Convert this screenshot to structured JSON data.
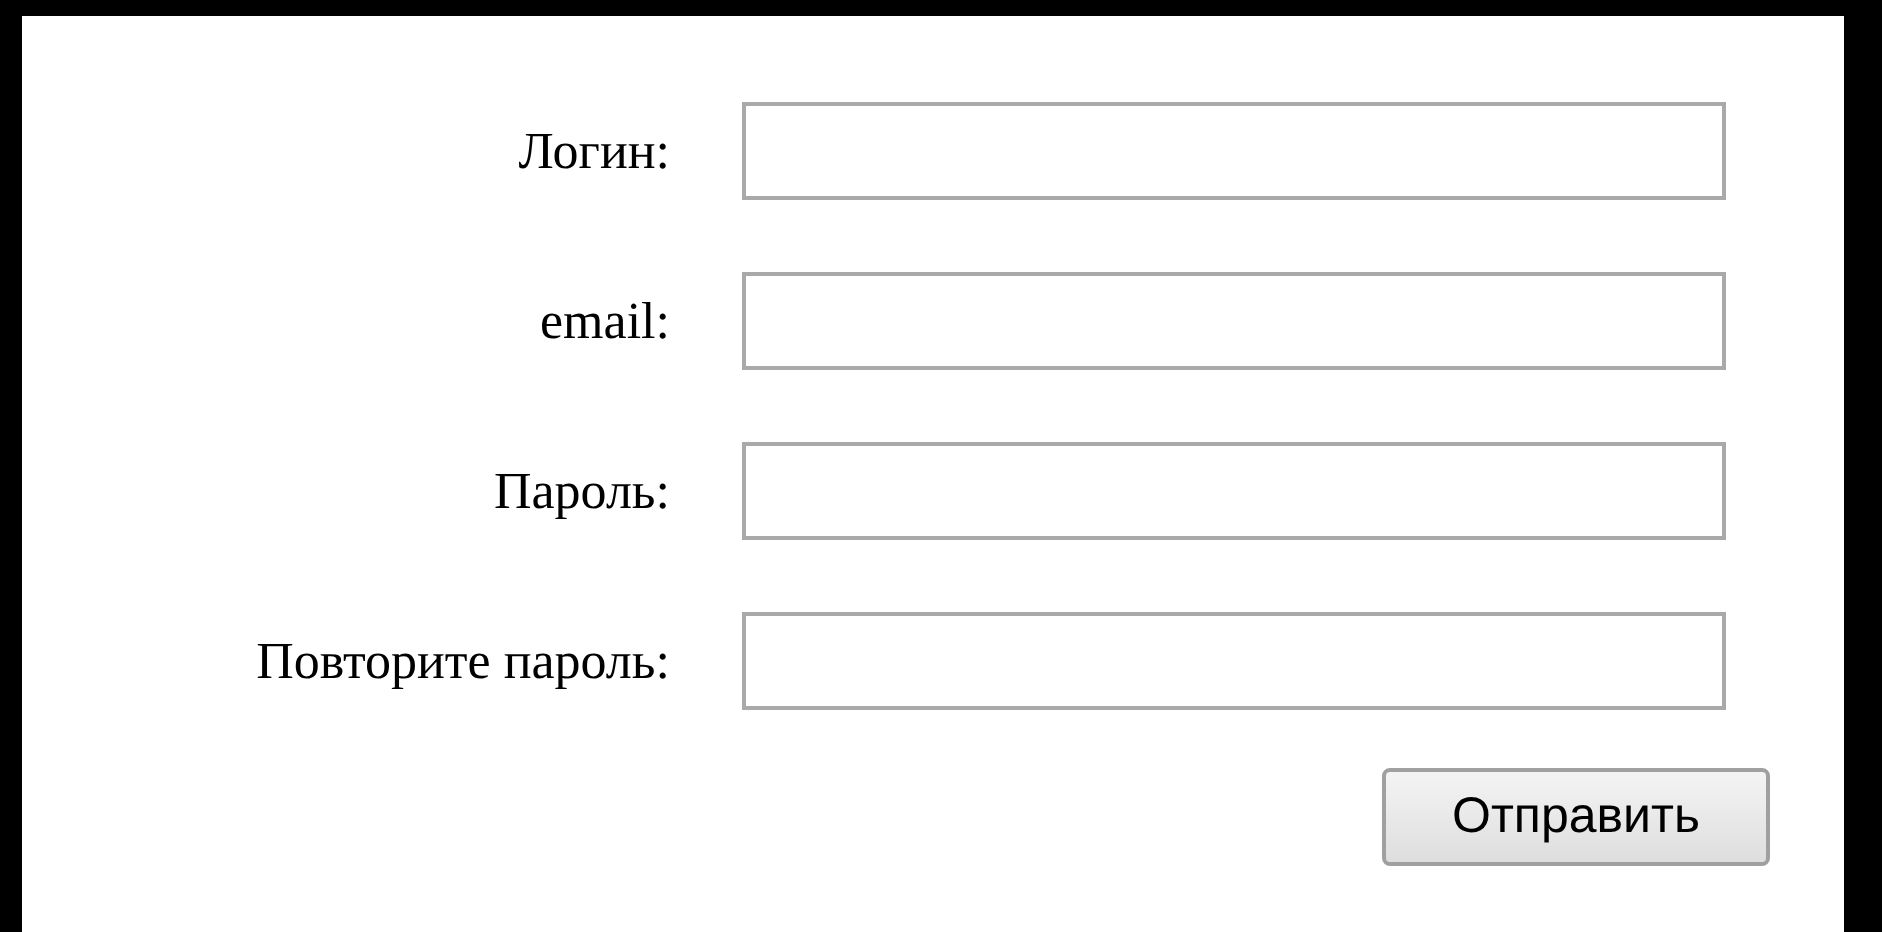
{
  "fields": [
    {
      "label": "Логин:"
    },
    {
      "label": "email:"
    },
    {
      "label": "Пароль:"
    },
    {
      "label": "Повторите пароль:"
    }
  ],
  "submit_button": "Отправить"
}
